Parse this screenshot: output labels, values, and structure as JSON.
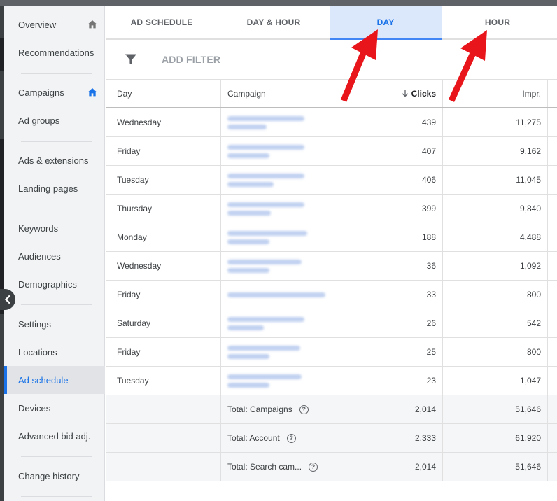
{
  "sidebar": {
    "items": [
      {
        "label": "Overview",
        "home_icon": true,
        "active": false
      },
      {
        "label": "Recommendations",
        "home_icon": false,
        "active": false
      },
      {
        "label": "Campaigns",
        "home_icon": true,
        "active": false
      },
      {
        "label": "Ad groups",
        "home_icon": false,
        "active": false
      },
      {
        "label": "Ads & extensions",
        "home_icon": false,
        "active": false
      },
      {
        "label": "Landing pages",
        "home_icon": false,
        "active": false
      },
      {
        "label": "Keywords",
        "home_icon": false,
        "active": false
      },
      {
        "label": "Audiences",
        "home_icon": false,
        "active": false
      },
      {
        "label": "Demographics",
        "home_icon": false,
        "active": false
      },
      {
        "label": "Settings",
        "home_icon": false,
        "active": false
      },
      {
        "label": "Locations",
        "home_icon": false,
        "active": false
      },
      {
        "label": "Ad schedule",
        "home_icon": false,
        "active": true
      },
      {
        "label": "Devices",
        "home_icon": false,
        "active": false
      },
      {
        "label": "Advanced bid adj.",
        "home_icon": false,
        "active": false
      },
      {
        "label": "Change history",
        "home_icon": false,
        "active": false
      }
    ]
  },
  "tabs": [
    {
      "label": "AD SCHEDULE",
      "active": false
    },
    {
      "label": "DAY & HOUR",
      "active": false
    },
    {
      "label": "DAY",
      "active": true
    },
    {
      "label": "HOUR",
      "active": false
    }
  ],
  "filter": {
    "label": "ADD FILTER",
    "icon": "filter-funnel-icon"
  },
  "table": {
    "columns": {
      "day": "Day",
      "campaign": "Campaign",
      "clicks": "Clicks",
      "impr": "Impr."
    },
    "sort": {
      "column": "clicks",
      "direction": "descending",
      "icon": "arrow-down-icon"
    },
    "rows": [
      {
        "day": "Wednesday",
        "clicks": "439",
        "impr": "11,275"
      },
      {
        "day": "Friday",
        "clicks": "407",
        "impr": "9,162"
      },
      {
        "day": "Tuesday",
        "clicks": "406",
        "impr": "11,045"
      },
      {
        "day": "Thursday",
        "clicks": "399",
        "impr": "9,840"
      },
      {
        "day": "Monday",
        "clicks": "188",
        "impr": "4,488"
      },
      {
        "day": "Wednesday",
        "clicks": "36",
        "impr": "1,092"
      },
      {
        "day": "Friday",
        "clicks": "33",
        "impr": "800"
      },
      {
        "day": "Saturday",
        "clicks": "26",
        "impr": "542"
      },
      {
        "day": "Friday",
        "clicks": "25",
        "impr": "800"
      },
      {
        "day": "Tuesday",
        "clicks": "23",
        "impr": "1,047"
      }
    ],
    "totals": [
      {
        "label": "Total: Campaigns",
        "clicks": "2,014",
        "impr": "51,646"
      },
      {
        "label": "Total: Account",
        "clicks": "2,333",
        "impr": "61,920"
      },
      {
        "label": "Total: Search cam...",
        "clicks": "2,014",
        "impr": "51,646"
      }
    ]
  },
  "colors": {
    "accent": "#1a73e8",
    "active_tab_bg": "#dbe7fa",
    "annotation_arrow": "#e8161b"
  }
}
